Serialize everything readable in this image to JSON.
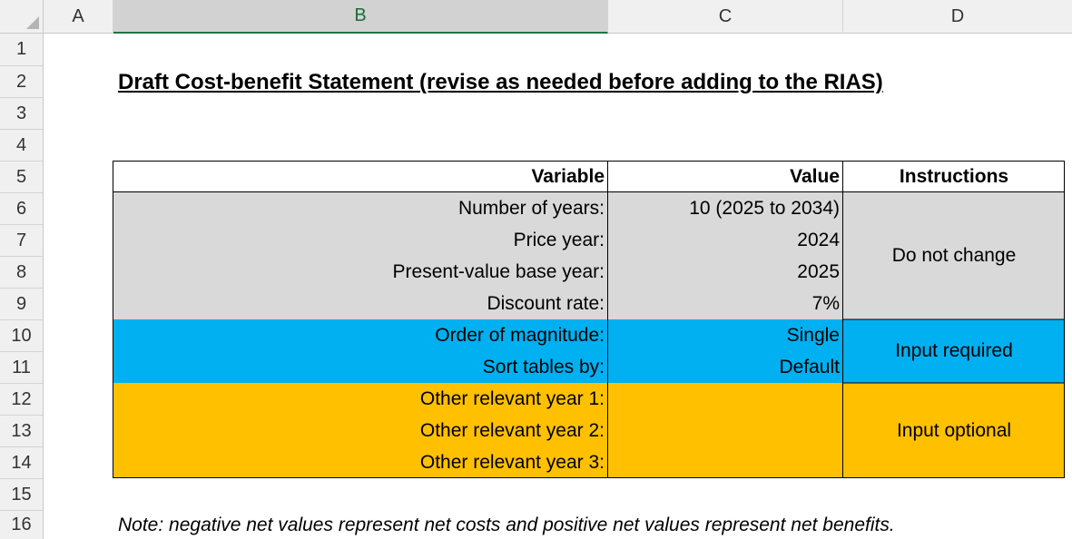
{
  "sheet": {
    "columns": [
      "A",
      "B",
      "C",
      "D"
    ],
    "rows": [
      "1",
      "2",
      "3",
      "4",
      "5",
      "6",
      "7",
      "8",
      "9",
      "10",
      "11",
      "12",
      "13",
      "14",
      "15",
      "16"
    ],
    "title": "Draft Cost-benefit Statement (revise as needed before adding to the RIAS)",
    "table": {
      "headers": {
        "variable": "Variable",
        "value": "Value",
        "instructions": "Instructions"
      },
      "rows": [
        {
          "variable": "Number of years:",
          "value": "10 (2025 to 2034)"
        },
        {
          "variable": "Price year:",
          "value": "2024"
        },
        {
          "variable": "Present-value base year:",
          "value": "2025"
        },
        {
          "variable": "Discount rate:",
          "value": "7%"
        },
        {
          "variable": "Order of magnitude:",
          "value": "Single"
        },
        {
          "variable": "Sort tables by:",
          "value": "Default"
        },
        {
          "variable": "Other relevant year 1:",
          "value": ""
        },
        {
          "variable": "Other relevant year 2:",
          "value": ""
        },
        {
          "variable": "Other relevant year 3:",
          "value": ""
        }
      ],
      "instructions": [
        "Do not change",
        "Input required",
        "Input optional"
      ]
    },
    "note": "Note: negative net values represent net costs and positive net values represent net benefits.",
    "colors": {
      "gray": "#d9d9d9",
      "blue": "#00b0f0",
      "gold": "#ffc000",
      "selected_header": "#217346"
    }
  }
}
